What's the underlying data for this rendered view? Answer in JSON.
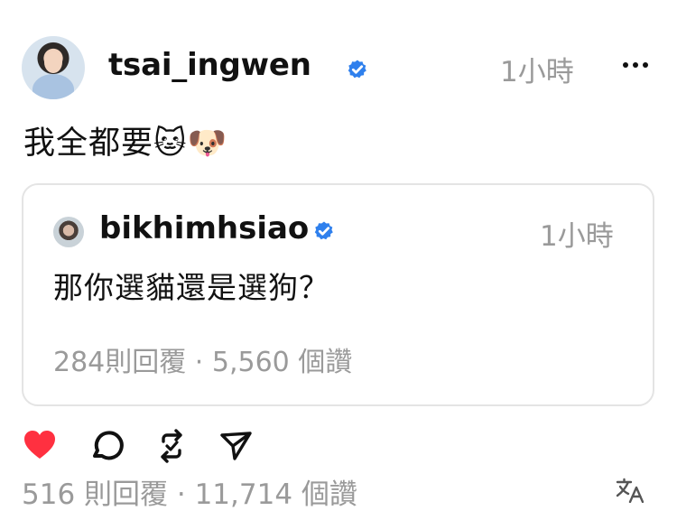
{
  "post": {
    "author": "tsai_ingwen",
    "time": "1小時",
    "text": "我全都要🐱🐶",
    "verified_color": "#2f80ed"
  },
  "quote": {
    "author": "bikhimhsiao",
    "time": "1小時",
    "text": "那你選貓還是選狗？",
    "stats": "284則回覆 · 5,560 個讚"
  },
  "footer": {
    "stats": "516 則回覆 · 11,714 個讚"
  },
  "icons": {
    "heart": "heart-icon",
    "comment": "comment-icon",
    "repost": "repost-icon",
    "share": "share-icon",
    "translate": "translate-icon",
    "more": "more-icon"
  },
  "colors": {
    "like": "#ff3040",
    "muted": "#9a9a9a",
    "border": "#e4e4e4"
  }
}
